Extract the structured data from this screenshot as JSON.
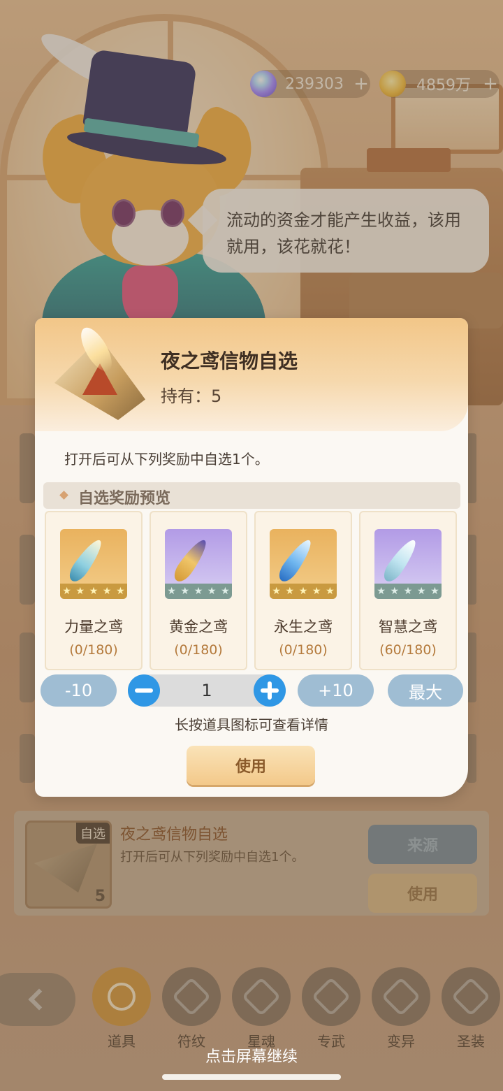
{
  "currency": {
    "gems": "239303",
    "gold": "4859万",
    "plus": "+"
  },
  "npc": {
    "speech": "流动的资金才能产生收益，该用就用，该花就花！"
  },
  "modal": {
    "title": "夜之鸢信物自选",
    "holding": "持有：5",
    "description": "打开后可从下列奖励中自选1个。",
    "preview_label": "自选奖励预览",
    "rewards": [
      {
        "name": "力量之鸢",
        "count": "(0/180)",
        "rarity": "gold",
        "stars": 5
      },
      {
        "name": "黄金之鸢",
        "count": "(0/180)",
        "rarity": "violet",
        "stars": 5
      },
      {
        "name": "永生之鸢",
        "count": "(0/180)",
        "rarity": "gold",
        "stars": 5
      },
      {
        "name": "智慧之鸢",
        "count": "(60/180)",
        "rarity": "violet",
        "stars": 5
      }
    ],
    "minus10": "-10",
    "quantity": "1",
    "plus10": "+10",
    "max": "最大",
    "hint": "长按道具图标可查看详情",
    "use": "使用"
  },
  "detail": {
    "badge": "自选",
    "count": "5",
    "title": "夜之鸢信物自选",
    "description": "打开后可从下列奖励中自选1个。",
    "source_button": "来源",
    "use_button": "使用"
  },
  "nav": {
    "items": [
      {
        "label": "道具",
        "active": true
      },
      {
        "label": "符纹",
        "active": false
      },
      {
        "label": "星魂",
        "active": false
      },
      {
        "label": "专武",
        "active": false
      },
      {
        "label": "变异",
        "active": false
      },
      {
        "label": "圣装",
        "active": false
      }
    ]
  },
  "footer": {
    "continue": "点击屏幕继续"
  },
  "colors": {
    "accent_blue": "#2f97e5",
    "modal_header": "#f2c688",
    "gold_rarity": "#e9b25e",
    "violet_rarity": "#b29be6"
  }
}
